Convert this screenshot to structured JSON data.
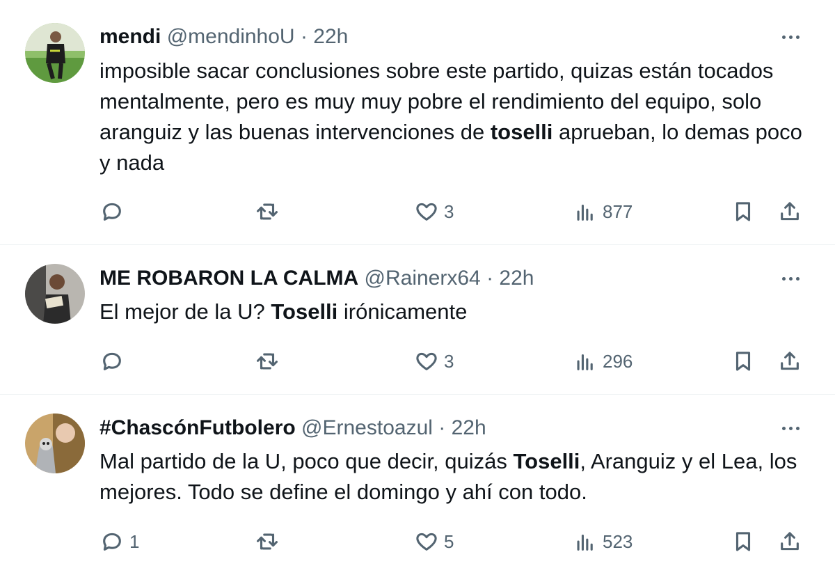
{
  "tweets": [
    {
      "name": "mendi",
      "handle": "@mendinhoU",
      "sep": "·",
      "time": "22h",
      "text_parts": {
        "a": "imposible sacar conclusiones sobre este partido, quizas están tocados mentalmente, pero es muy muy pobre el rendimiento del equipo, solo aranguiz y las buenas intervenciones de ",
        "b": "toselli",
        "c": " aprueban, lo demas poco y nada"
      },
      "replies": "",
      "retweets": "",
      "likes": "3",
      "views": "877"
    },
    {
      "name": "ME ROBARON LA CALMA",
      "handle": "@Rainerx64",
      "sep": "·",
      "time": "22h",
      "text_parts": {
        "a": "El mejor de la U? ",
        "b": "Toselli",
        "c": " irónicamente"
      },
      "replies": "",
      "retweets": "",
      "likes": "3",
      "views": "296"
    },
    {
      "name": "#ChascónFutbolero",
      "handle": "@Ernestoazul",
      "sep": "·",
      "time": "22h",
      "text_parts": {
        "a": "Mal partido de la U, poco que decir, quizás ",
        "b": "Toselli",
        "c": ", Aranguiz y el Lea, los mejores. Todo se define el domingo y ahí con todo."
      },
      "replies": "1",
      "retweets": "",
      "likes": "5",
      "views": "523"
    }
  ],
  "icons": {
    "reply": "reply-icon",
    "retweet": "retweet-icon",
    "like": "heart-icon",
    "views": "views-icon",
    "bookmark": "bookmark-icon",
    "share": "share-icon",
    "more": "more-icon"
  },
  "colors": {
    "text": "#0f1419",
    "secondary": "#536471",
    "divider": "#eff3f4"
  }
}
